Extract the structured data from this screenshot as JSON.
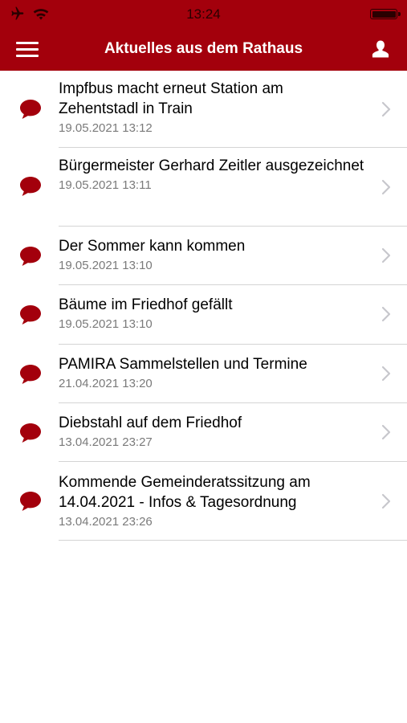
{
  "status_bar": {
    "time": "13:24",
    "airplane_icon": "airplane-icon",
    "wifi_icon": "wifi-icon",
    "battery_icon": "battery-icon"
  },
  "nav": {
    "title": "Aktuelles aus dem Rathaus",
    "menu_icon": "hamburger-menu-icon",
    "profile_icon": "user-profile-icon"
  },
  "colors": {
    "brand": "#a3000c",
    "bubble": "#a3000c",
    "chevron": "#c7c7cc",
    "separator": "#d4d4d4",
    "date_text": "#7a7a7a"
  },
  "news": [
    {
      "title": "Impfbus macht erneut Station am Zehentstadl in Train",
      "date": "19.05.2021 13:12"
    },
    {
      "title": "Bürgermeister Gerhard Zeitler ausgezeichnet",
      "date": "19.05.2021 13:11"
    },
    {
      "title": "Der Sommer kann kommen",
      "date": "19.05.2021 13:10"
    },
    {
      "title": "Bäume im Friedhof gefällt",
      "date": "19.05.2021 13:10"
    },
    {
      "title": "PAMIRA Sammelstellen und Termine",
      "date": "21.04.2021 13:20"
    },
    {
      "title": "Diebstahl auf dem Friedhof",
      "date": "13.04.2021 23:27"
    },
    {
      "title": "Kommende Gemeinderatssitzung am 14.04.2021 - Infos & Tagesordnung",
      "date": "13.04.2021 23:26"
    }
  ]
}
